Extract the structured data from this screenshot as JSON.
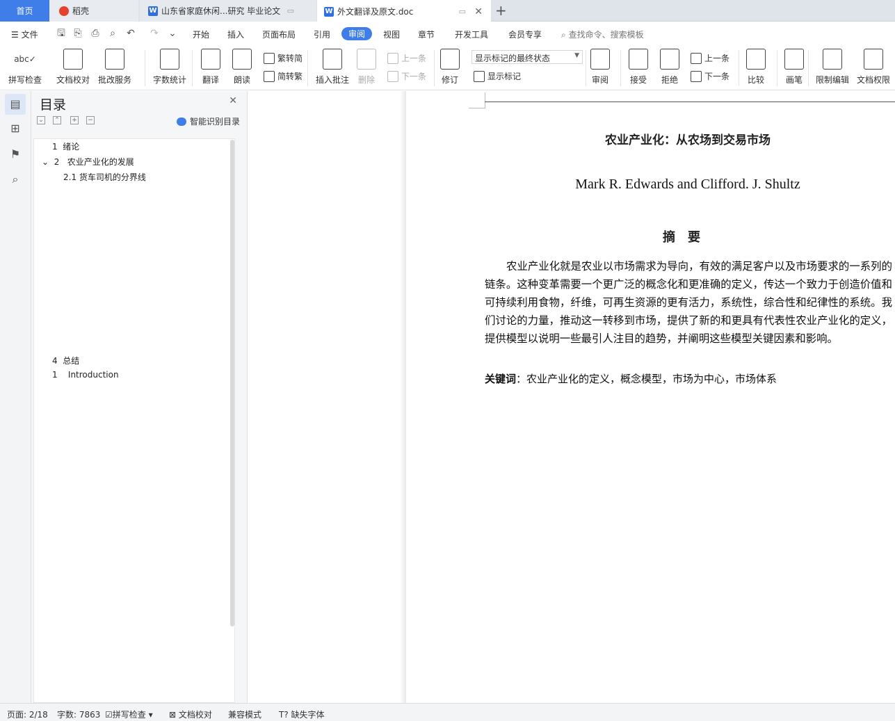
{
  "tabs": {
    "home": "首页",
    "daoke": "稻壳",
    "doc1": "山东省家庭休闲...研究 毕业论文",
    "doc2": "外文翻译及原文.doc",
    "new": "+"
  },
  "menu": {
    "file": "文件",
    "items": [
      "开始",
      "插入",
      "页面布局",
      "引用",
      "审阅",
      "视图",
      "章节",
      "开发工具",
      "会员专享"
    ],
    "search": "查找命令、搜索模板"
  },
  "ribbon": {
    "spell": "拼写检查",
    "proof": "文档校对",
    "revise_service": "批改服务",
    "wordcount": "字数统计",
    "translate": "翻译",
    "read": "朗读",
    "trad_to_simp": "繁转简",
    "simp_to_trad": "简转繁",
    "insert_comment": "插入批注",
    "delete": "删除",
    "prev": "上一条",
    "next": "下一条",
    "track": "修订",
    "markup_state": "显示标记的最终状态",
    "show_markup": "显示标记",
    "review": "审阅",
    "accept": "接受",
    "reject": "拒绝",
    "prev2": "上一条",
    "next2": "下一条",
    "compare": "比较",
    "pen": "画笔",
    "restrict": "限制编辑",
    "permission": "文档权限"
  },
  "toc": {
    "title": "目录",
    "smart": "智能识别目录",
    "items": [
      {
        "num": "1",
        "text": "绪论"
      },
      {
        "num": "2",
        "text": "农业产业化的发展"
      },
      {
        "num": "",
        "text": "2.1 货车司机的分界线"
      },
      {
        "num": "4",
        "text": "总结"
      },
      {
        "num": "1",
        "text": "Introduction"
      }
    ]
  },
  "doc": {
    "title": "农业产业化：从农场到交易市场",
    "authors": "Mark R. Edwards and Clifford. J. Shultz",
    "abstract_heading": "摘要",
    "abstract": "农业产业化就是农业以市场需求为导向，有效的满足客户以及市场要求的一系列的链条。这种变革需要一个更广泛的概念化和更准确的定义，传达一个致力于创造价值和可持续利用食物，纤维，可再生资源的更有活力，系统性，综合性和纪律性的系统。我们讨论的力量，推动这一转移到市场，提供了新的和更具有代表性农业产业化的定义，提供模型以说明一些最引人注目的趋势，并阐明这些模型关键因素和影响。",
    "keywords_label": "关键词",
    "keywords": "：农业产业化的定义，概念模型，市场为中心，市场体系"
  },
  "status": {
    "page": "页面: 2/18",
    "words": "字数: 7863",
    "spell": "拼写检查",
    "proof": "文档校对",
    "compat": "兼容模式",
    "missing_font": "缺失字体"
  }
}
